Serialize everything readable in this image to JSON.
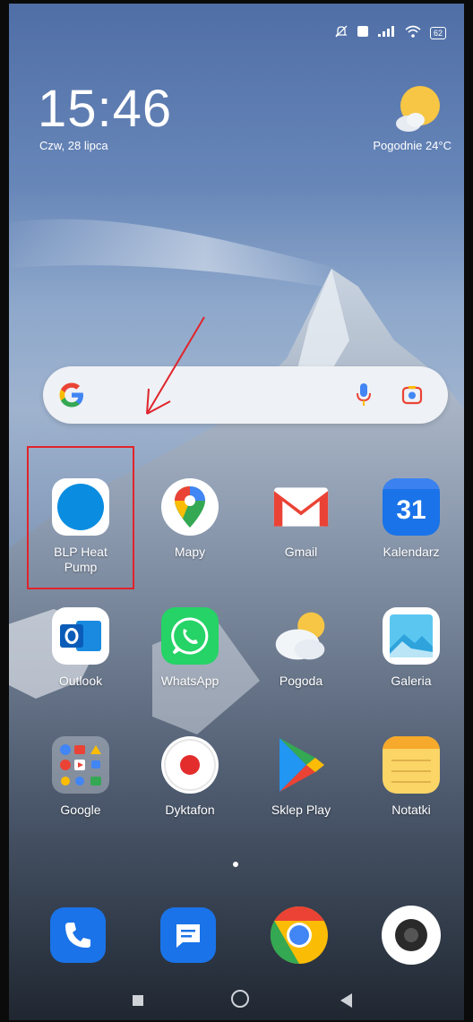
{
  "status_bar": {
    "battery": "62"
  },
  "clock": {
    "time": "15:46",
    "date": "Czw, 28 lipca"
  },
  "weather": {
    "text": "Pogodnie  24°C"
  },
  "search_bar": {
    "logo": "G"
  },
  "apps_row1": [
    {
      "label": "BLP Heat\nPump"
    },
    {
      "label": "Mapy"
    },
    {
      "label": "Gmail"
    },
    {
      "label": "Kalendarz",
      "day": "31"
    }
  ],
  "apps_row2": [
    {
      "label": "Outlook"
    },
    {
      "label": "WhatsApp"
    },
    {
      "label": "Pogoda"
    },
    {
      "label": "Galeria"
    }
  ],
  "apps_row3": [
    {
      "label": "Google"
    },
    {
      "label": "Dyktafon"
    },
    {
      "label": "Sklep Play"
    },
    {
      "label": "Notatki"
    }
  ],
  "dock": [
    "phone-icon",
    "messages-icon",
    "chrome-icon",
    "camera-icon"
  ],
  "colors": {
    "annotation": "#e0242b",
    "accent_blue": "#0a8de0"
  }
}
